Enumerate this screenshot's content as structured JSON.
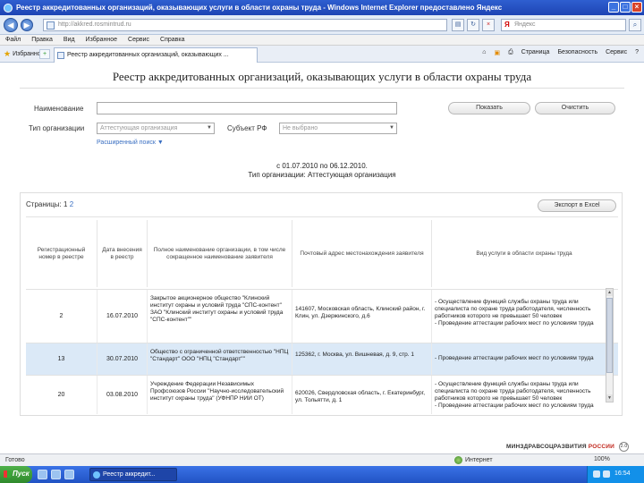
{
  "window": {
    "title": "Реестр аккредитованных организаций, оказывающих услуги в области охраны труда - Windows Internet Explorer предоставлено Яндекс"
  },
  "address": {
    "url": "http://akkred.rosmintrud.ru",
    "search_placeholder": "Яндекс"
  },
  "menu": [
    "Файл",
    "Правка",
    "Вид",
    "Избранное",
    "Сервис",
    "Справка"
  ],
  "favorites": {
    "label": "Избранное"
  },
  "tab": {
    "label": "Реестр аккредитованных организаций, оказывающих ..."
  },
  "commands": [
    "Страница",
    "Безопасность",
    "Сервис"
  ],
  "page": {
    "title": "Реестр аккредитованных организаций, оказывающих услуги в области охраны труда",
    "form": {
      "name_label": "Наименование",
      "name_value": "",
      "type_label": "Тип организации",
      "type_value": "Аттестующая организация",
      "subject_label": "Субъект РФ",
      "subject_value": "Не выбрано",
      "search_button": "Показать",
      "clear_button": "Очистить",
      "advanced_link": "Расширенный поиск"
    },
    "period_line1": "с 01.07.2010 по 06.12.2010.",
    "period_line2": "Тип организации: Аттестующая организация",
    "pager": {
      "label": "Страницы:",
      "current": "1",
      "next": "2"
    },
    "export_button": "Экспорт в Excel",
    "table": {
      "headers": [
        "Регистрационный номер в реестре",
        "Дата внесения в реестр",
        "Полное наименование организации, в том числе сокращенное наименование заявителя",
        "Почтовый адрес местонахождения заявителя",
        "Вид услуги в области охраны труда"
      ],
      "rows": [
        {
          "num": "2",
          "date": "16.07.2010",
          "name": "Закрытое акционерное общество \"Клинский институт охраны и условий труда \"СПС-контент\" ЗАО \"Клинский институт охраны и условий труда \"СПС-контент\"\"",
          "address": "141607, Московская область, Клинский район, г. Клин, ул. Дзержинского, д.6",
          "service": "- Осуществление функций службы охраны труда или специалиста по охране труда работодателя, численность работников которого не превышает 50 человек\n- Проведение аттестации рабочих мест по условиям труда"
        },
        {
          "num": "13",
          "date": "30.07.2010",
          "name": "Общество с ограниченной ответственностью \"НПЦ \"Стандарт\" ООО \"НПЦ \"Стандарт\"\"",
          "address": "125362, г. Москва, ул. Вишневая, д. 9, стр. 1",
          "service": "- Проведение аттестации рабочих мест по условиям труда"
        },
        {
          "num": "20",
          "date": "03.08.2010",
          "name": "Учреждение Федерации Независимых Профсоюзов России \"Научно-исследовательский институт охраны труда\" (УФНПР НИИ ОТ)",
          "address": "620026, Свердловская область, г. Екатеринбург, ул. Тольятти, д. 1",
          "service": "- Осуществление функций службы охраны труда или специалиста по охране труда работодателя, численность работников которого не превышает 50 человек\n- Проведение аттестации рабочих мест по условиям труда"
        }
      ]
    },
    "footer_org": "МИНЗДРАВСОЦРАЗВИТИЯ",
    "footer_country": "РОССИИ",
    "footer_badge": "2.0"
  },
  "status": {
    "text": "Готово",
    "zone": "Интернет",
    "zoom": "100%"
  },
  "taskbar": {
    "start": "Пуск",
    "window": "Реестр аккредит...",
    "clock": "16:54"
  }
}
